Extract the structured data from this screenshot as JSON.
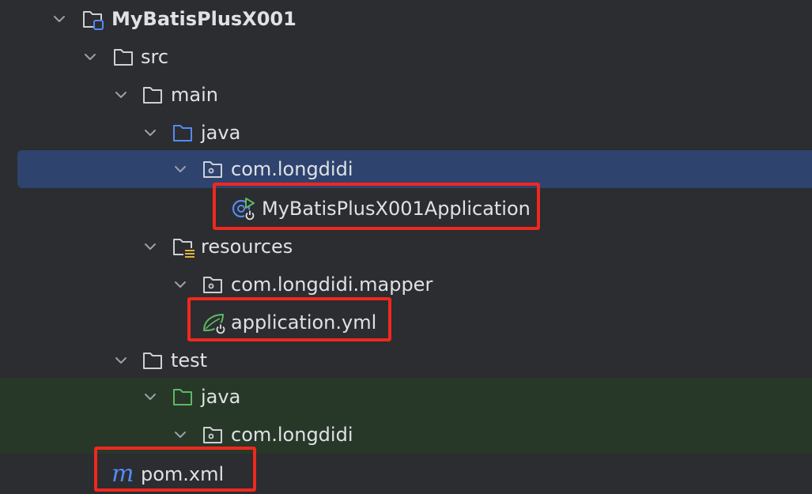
{
  "tree": {
    "project": "MyBatisPlusX001",
    "src": "src",
    "main": "main",
    "main_java": "java",
    "main_package": "com.longdidi",
    "app_class": "MyBatisPlusX001Application",
    "resources": "resources",
    "mapper_package": "com.longdidi.mapper",
    "app_yml": "application.yml",
    "test": "test",
    "test_java": "java",
    "test_package": "com.longdidi",
    "pom": "pom.xml",
    "pom_icon_glyph": "m"
  },
  "colors": {
    "background": "#2b2d30",
    "selected_row": "#2e436e",
    "test_rows": "#273828",
    "highlight_box": "#f0281e",
    "source_folder": "#548af7",
    "test_folder": "#5fb865"
  },
  "icons": {
    "chevron": "chevron-down-icon",
    "folder": "folder-icon",
    "module": "module-folder-icon",
    "package": "package-icon",
    "resources": "resources-folder-icon",
    "spring_boot_app": "spring-boot-application-icon",
    "spring_yml": "spring-config-icon",
    "maven": "maven-icon"
  }
}
